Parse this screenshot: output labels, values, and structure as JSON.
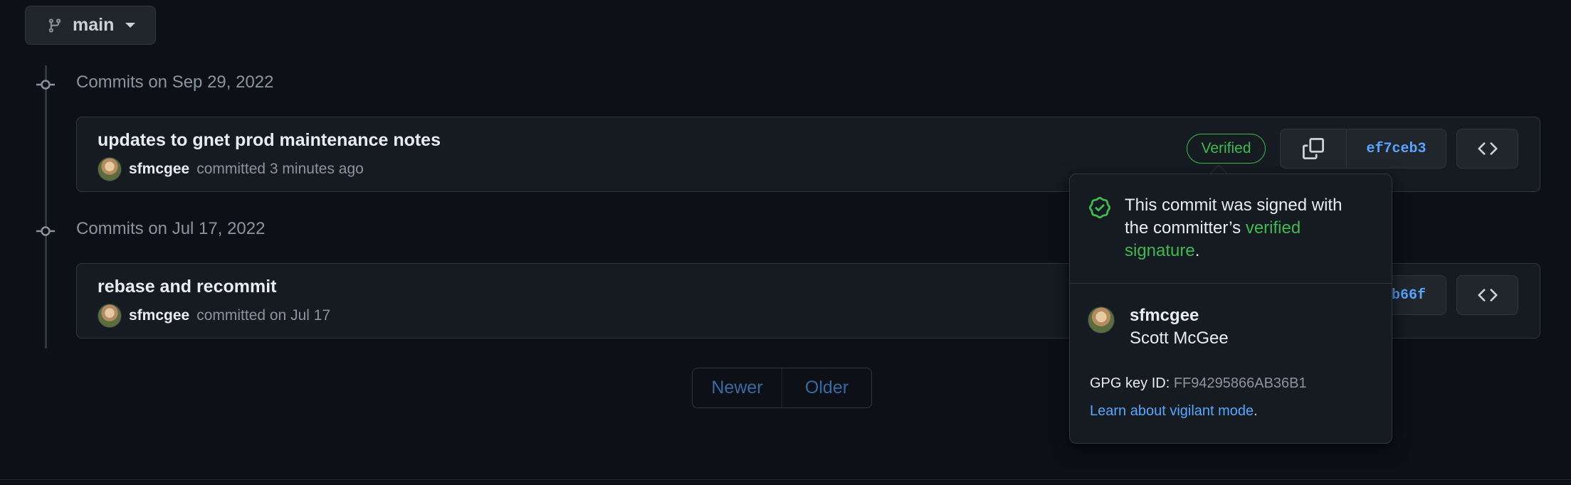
{
  "branch": {
    "name": "main"
  },
  "groups": [
    {
      "heading": "Commits on Sep 29, 2022",
      "commit": {
        "title": "updates to gnet prod maintenance notes",
        "author": "sfmcgee",
        "meta": "committed 3 minutes ago",
        "badge": "Verified",
        "sha": "ef7ceb3"
      }
    },
    {
      "heading": "Commits on Jul 17, 2022",
      "commit": {
        "title": "rebase and recommit",
        "author": "sfmcgee",
        "meta": "committed on Jul 17",
        "sha": "b66f"
      }
    }
  ],
  "pagination": {
    "newer": "Newer",
    "older": "Older"
  },
  "popover": {
    "message_prefix": "This commit was signed with the committer’s ",
    "message_link": "verified signature",
    "message_suffix": ".",
    "login": "sfmcgee",
    "full_name": "Scott McGee",
    "gpg_label": "GPG key ID:",
    "gpg_key": "FF94295866AB36B1",
    "learn_link": "Learn about vigilant mode",
    "learn_suffix": "."
  },
  "icons": {
    "branch": "git-branch-icon",
    "caret": "caret-down-icon",
    "commit_node": "git-commit-icon",
    "copy": "copy-icon",
    "code": "code-icon",
    "verified": "verified-check-icon"
  },
  "colors": {
    "background": "#0d1117",
    "surface": "#161b22",
    "border": "#30363d",
    "accent": "#58a6ff",
    "success": "#3fb950"
  }
}
